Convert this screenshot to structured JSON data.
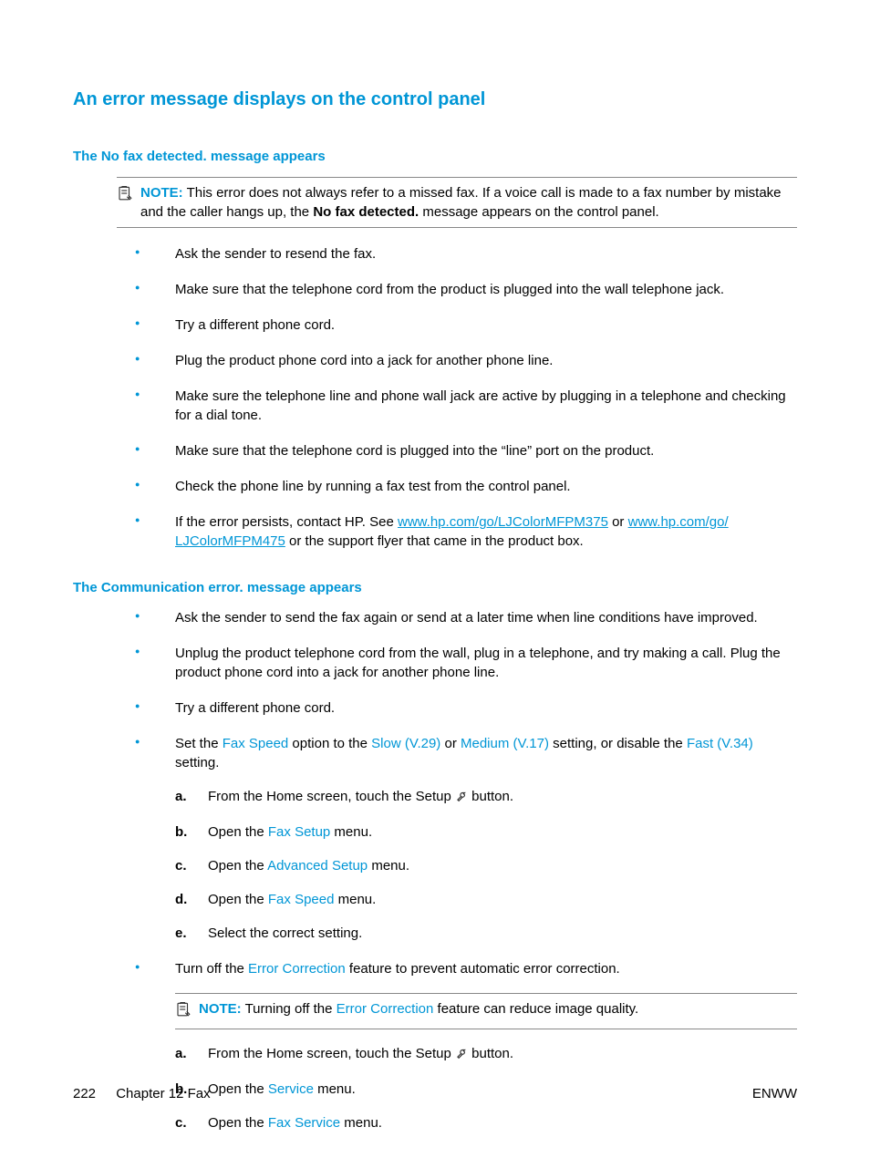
{
  "heading": "An error message displays on the control panel",
  "section1": {
    "title": "The No fax detected. message appears",
    "note_label": "NOTE:",
    "note_pre": "This error does not always refer to a missed fax. If a voice call is made to a fax number by mistake and the caller hangs up, the ",
    "note_bold": "No fax detected.",
    "note_post": " message appears on the control panel.",
    "b1": "Ask the sender to resend the fax.",
    "b2": "Make sure that the telephone cord from the product is plugged into the wall telephone jack.",
    "b3": "Try a different phone cord.",
    "b4": "Plug the product phone cord into a jack for another phone line.",
    "b5": "Make sure the telephone line and phone wall jack are active by plugging in a telephone and checking for a dial tone.",
    "b6": "Make sure that the telephone cord is plugged into the “line” port on the product.",
    "b7": "Check the phone line by running a fax test from the control panel.",
    "b8_pre": "If the error persists, contact HP. See ",
    "b8_link1": "www.hp.com/go/LJColorMFPM375",
    "b8_mid": " or ",
    "b8_link2a": "www.hp.com/go/",
    "b8_link2b": "LJColorMFPM475",
    "b8_post": " or the support flyer that came in the product box."
  },
  "section2": {
    "title": "The Communication error. message appears",
    "b1": "Ask the sender to send the fax again or send at a later time when line conditions have improved.",
    "b2": "Unplug the product telephone cord from the wall, plug in a telephone, and try making a call. Plug the product phone cord into a jack for another phone line.",
    "b3": "Try a different phone cord.",
    "b4_pre": "Set the ",
    "b4_t1": "Fax Speed",
    "b4_mid1": " option to the ",
    "b4_t2": "Slow (V.29)",
    "b4_mid2": " or ",
    "b4_t3": "Medium (V.17)",
    "b4_mid3": " setting, or disable the ",
    "b4_t4": "Fast (V.34)",
    "b4_post": " setting.",
    "s_a_pre": "From the Home screen, touch the Setup ",
    "s_a_post": " button.",
    "s_b_pre": "Open the ",
    "s_b_t": "Fax Setup",
    "s_b_post": " menu.",
    "s_c_pre": "Open the ",
    "s_c_t": "Advanced Setup",
    "s_c_post": " menu.",
    "s_d_pre": "Open the ",
    "s_d_t": "Fax Speed",
    "s_d_post": " menu.",
    "s_e": "Select the correct setting.",
    "b5_pre": "Turn off the ",
    "b5_t": "Error Correction",
    "b5_post": " feature to prevent automatic error correction.",
    "note_label": "NOTE:",
    "note_pre": "Turning off the ",
    "note_t": "Error Correction",
    "note_post": " feature can reduce image quality.",
    "s2_a_pre": "From the Home screen, touch the Setup ",
    "s2_a_post": " button.",
    "s2_b_pre": "Open the ",
    "s2_b_t": "Service",
    "s2_b_post": " menu.",
    "s2_c_pre": "Open the ",
    "s2_c_t": "Fax Service",
    "s2_c_post": " menu."
  },
  "footer": {
    "page": "222",
    "chapter": "Chapter 12   Fax",
    "right": "ENWW"
  },
  "labels": {
    "a": "a.",
    "b": "b.",
    "c": "c.",
    "d": "d.",
    "e": "e."
  }
}
